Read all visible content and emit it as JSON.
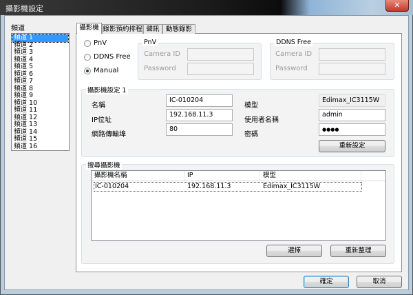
{
  "window": {
    "title": "攝影機設定",
    "close_icon": "close-icon"
  },
  "channels": {
    "label": "頻道",
    "items": [
      "頻道 1",
      "頻道 2",
      "頻道 3",
      "頻道 4",
      "頻道 5",
      "頻道 6",
      "頻道 7",
      "頻道 8",
      "頻道 9",
      "頻道 10",
      "頻道 11",
      "頻道 12",
      "頻道 13",
      "頻道 14",
      "頻道 15",
      "頻道 16"
    ],
    "selected": "頻道 1"
  },
  "tabs": [
    "攝影機",
    "錄影預約排程",
    "聲訊",
    "動態錄影"
  ],
  "mode": {
    "options": [
      "PnV",
      "DDNS Free",
      "Manual"
    ],
    "selected": "Manual"
  },
  "pnv": {
    "title": "PnV",
    "camera_id_label": "Camera ID",
    "password_label": "Password"
  },
  "ddns": {
    "title": "DDNS Free",
    "camera_id_label": "Camera ID",
    "password_label": "Password"
  },
  "camera": {
    "title": "攝影機設定 1",
    "name_label": "名稱",
    "name": "IC-010204",
    "ip_label": "IP位址",
    "ip": "192.168.11.3",
    "port_label": "網路傳輸埠",
    "port": "80",
    "model_label": "模型",
    "model": "Edimax_IC3115W",
    "user_label": "使用者名稱",
    "user": "admin",
    "password_label": "密碼",
    "password": "●●●●",
    "reset_label": "重新設定"
  },
  "search": {
    "title": "搜尋攝影機",
    "columns": [
      "攝影機名稱",
      "IP",
      "模型"
    ],
    "rows": [
      [
        "IC-010204",
        "192.168.11.3",
        "Edimax_IC3115W"
      ]
    ],
    "select_label": "選擇",
    "refresh_label": "重新整理"
  },
  "footer": {
    "ok_label": "確定",
    "cancel_label": "取消"
  }
}
